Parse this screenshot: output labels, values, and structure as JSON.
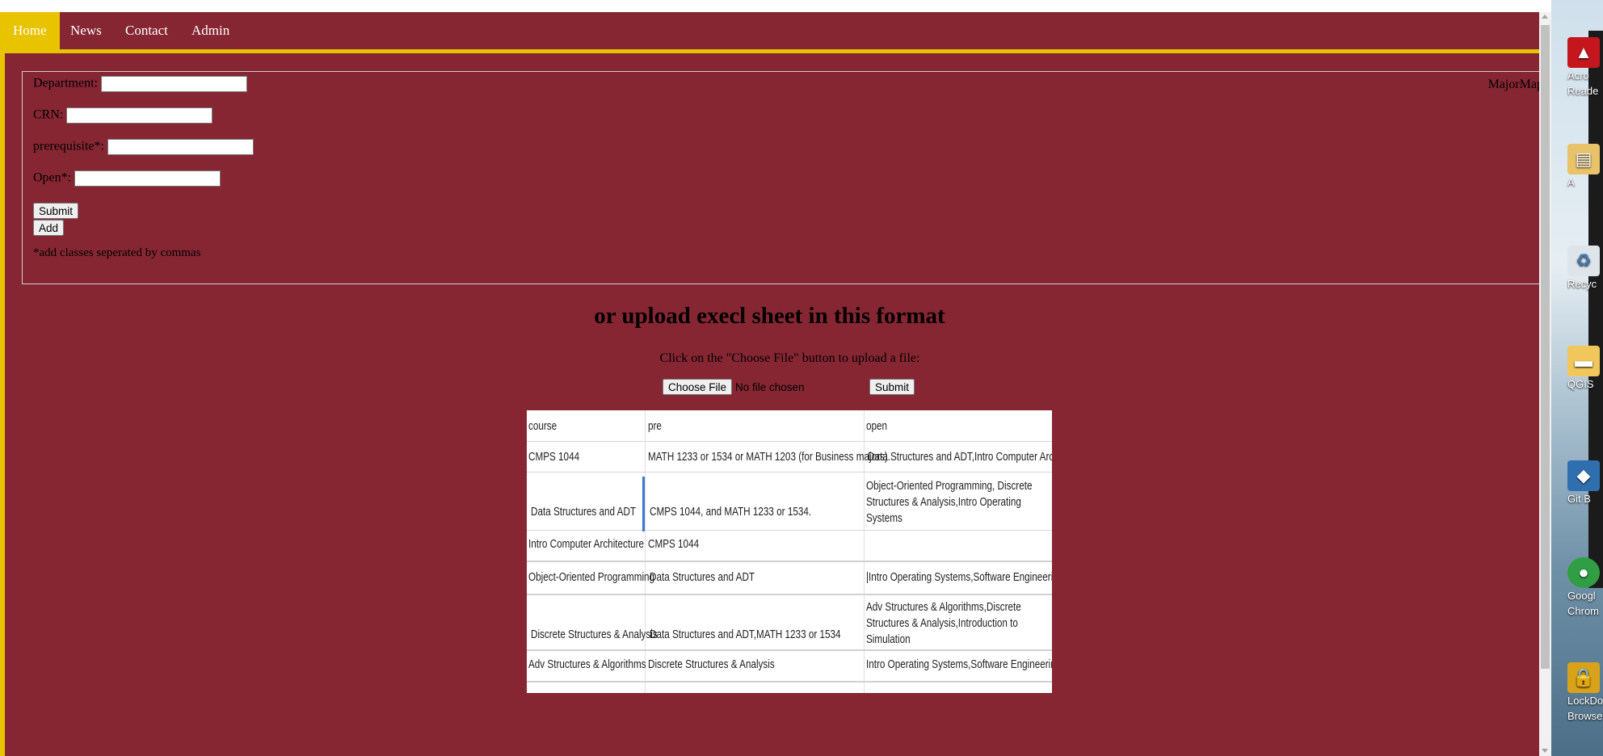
{
  "nav": {
    "items": [
      {
        "label": "Home",
        "active": true
      },
      {
        "label": "News",
        "active": false
      },
      {
        "label": "Contact",
        "active": false
      },
      {
        "label": "Admin",
        "active": false
      }
    ]
  },
  "form": {
    "department_label": "Department:",
    "crn_label": "CRN:",
    "prerequisite_label": "prerequisite*:",
    "open_label": "Open*:",
    "department_value": "",
    "crn_value": "",
    "prerequisite_value": "",
    "open_value": "",
    "submit_label": "Submit",
    "add_label": "Add",
    "note": "*add classes seperated by commas",
    "majormap_text": "MajorMap"
  },
  "upload": {
    "title": "or upload execl sheet in this format",
    "instruction": "Click on the \"Choose File\" button to upload a file:",
    "choose_label": "Choose File",
    "file_status": "No file chosen",
    "submit_label": "Submit"
  },
  "sheet": {
    "headers": [
      "course",
      "pre",
      "open"
    ],
    "rows": [
      [
        "CMPS 1044",
        "MATH 1233 or 1534 or MATH 1203 (for Business majors).",
        "Data Structures and ADT,Intro Computer Architecture"
      ],
      [
        "Data Structures and ADT",
        "CMPS 1044, and MATH 1233 or 1534.",
        "Object-Oriented Programming, Discrete Structures & Analysis,Intro Operating Systems"
      ],
      [
        "Intro Computer Architecture",
        "CMPS 1044",
        ""
      ],
      [
        "Object-Oriented Programming",
        "Data Structures and ADT",
        "|Intro Operating Systems,Software Engineering"
      ],
      [
        "Discrete Structures & Analysis",
        "Data Structures and ADT,MATH 1233 or 1534",
        "Adv Structures & Algorithms,Discrete Structures & Analysis,Introduction to Simulation"
      ],
      [
        "Adv Structures & Algorithms",
        "Discrete Structures & Analysis",
        "Intro Operating Systems,Software Engineering"
      ]
    ]
  },
  "desktop": {
    "icons": [
      {
        "name": "acrobat-reader-icon",
        "label": "Acro Reade",
        "color": "#c4161c"
      },
      {
        "name": "pdf-file-icon",
        "label": "A",
        "color": "#e8c36a"
      },
      {
        "name": "recycle-bin-icon",
        "label": "Recyc",
        "color": "#dde5ea"
      },
      {
        "name": "qgis-folder-icon",
        "label": "QGIS",
        "color": "#f1c75c"
      },
      {
        "name": "git-bash-icon",
        "label": "Git B",
        "color": "#2f6fb0"
      },
      {
        "name": "google-chrome-icon",
        "label": "Googl Chrom",
        "color": "#2f9e44"
      },
      {
        "name": "lockdown-browser-icon",
        "label": "LockDo Browse",
        "color": "#d9a21b"
      }
    ]
  },
  "colors": {
    "background": "#862633",
    "accent": "#e8c300"
  }
}
